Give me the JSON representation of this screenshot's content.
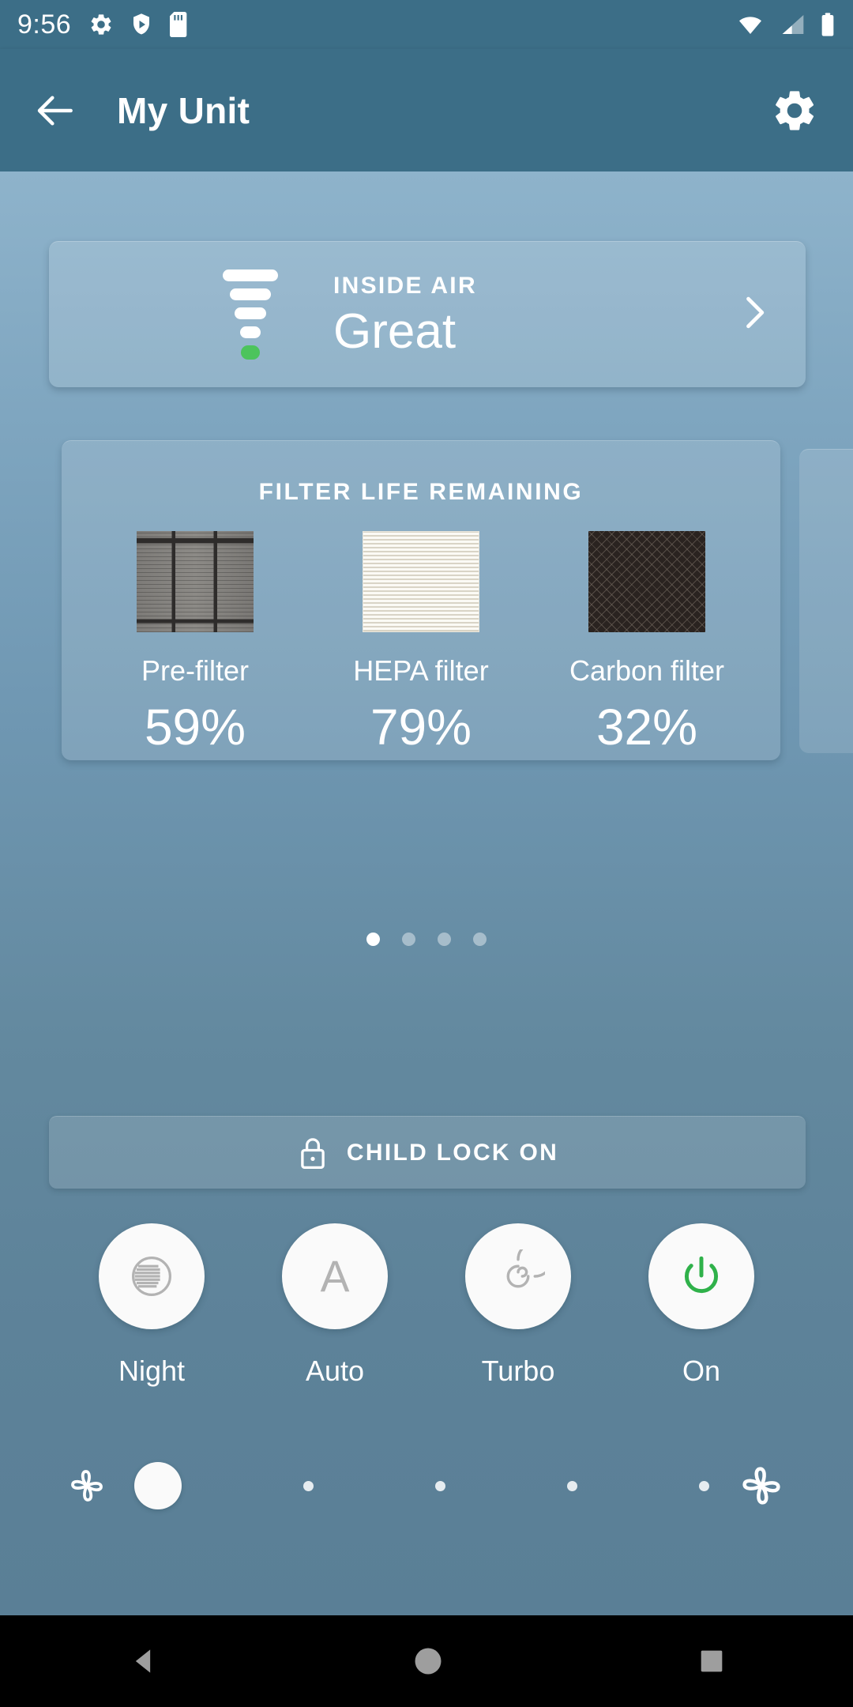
{
  "statusbar": {
    "time": "9:56",
    "left_icons": [
      "gear-icon",
      "shield-play-icon",
      "sd-card-icon"
    ],
    "right_icons": [
      "wifi-icon",
      "cell-signal-icon",
      "battery-icon"
    ]
  },
  "appbar": {
    "back_icon": "arrow-left-icon",
    "title": "My Unit",
    "settings_icon": "gear-icon"
  },
  "air_quality": {
    "label": "INSIDE AIR",
    "value": "Great",
    "indicator_active_color": "#4cc45c",
    "chevron_icon": "chevron-right-icon"
  },
  "filter_card": {
    "title": "FILTER LIFE REMAINING",
    "filters": [
      {
        "name": "Pre-filter",
        "percent": "59%"
      },
      {
        "name": "HEPA filter",
        "percent": "79%"
      },
      {
        "name": "Carbon filter",
        "percent": "32%"
      }
    ]
  },
  "pager": {
    "count": 4,
    "active_index": 0
  },
  "child_lock": {
    "icon": "lock-icon",
    "label": "CHILD LOCK ON"
  },
  "modes": [
    {
      "label": "Night",
      "icon": "night-mode-icon"
    },
    {
      "label": "Auto",
      "icon": "auto-mode-icon"
    },
    {
      "label": "Turbo",
      "icon": "turbo-mode-icon"
    },
    {
      "label": "On",
      "icon": "power-icon"
    }
  ],
  "power_color": "#2fb14a",
  "fan_speed": {
    "left_icon": "fan-low-icon",
    "right_icon": "fan-high-icon",
    "steps": 5,
    "selected_index": 0
  },
  "navbar": {
    "back": "nav-back-triangle-icon",
    "home": "nav-home-circle-icon",
    "recents": "nav-recents-square-icon"
  },
  "theme": {
    "appbar_bg": "#3c6e87",
    "card_text": "#ffffff"
  }
}
